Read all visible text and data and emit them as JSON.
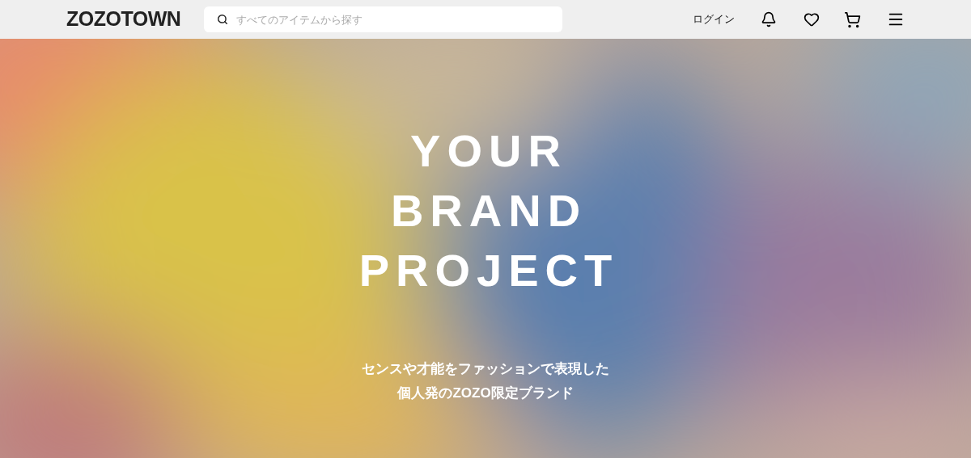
{
  "header": {
    "logo": "ZOZOTOWN",
    "search": {
      "placeholder": "すべてのアイテムから探す"
    },
    "login": "ログイン"
  },
  "hero": {
    "kind": "picture",
    "title_lines": [
      "YOUR",
      "BRAND",
      "PROJECT"
    ],
    "subtitle_lines": [
      "センスや才能をファッションで表現した",
      "個人発のZOZO限定ブランド"
    ]
  }
}
